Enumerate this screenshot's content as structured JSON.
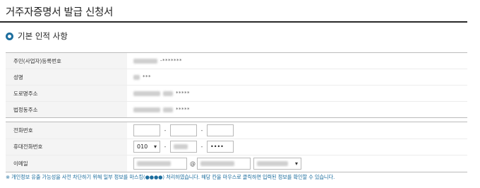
{
  "page": {
    "title": "거주자증명서 발급 신청서",
    "section_title": "기본 인적 사항"
  },
  "personal": {
    "rows": [
      {
        "label": "주민(사업자)등록번호",
        "masked": "-*******"
      },
      {
        "label": "성명",
        "masked": "***"
      },
      {
        "label": "도로명주소",
        "masked": "*****"
      },
      {
        "label": "법정동주소",
        "masked": "*****"
      }
    ]
  },
  "contact": {
    "phone_label": "전화번호",
    "mobile_label": "휴대전화번호",
    "mobile_prefix": "010",
    "mobile_last": "••••",
    "email_label": "이메일",
    "email_at": "@"
  },
  "notice": "※ 개인정보 유출 가능성을 사전 차단하기 위해 일부 정보를 마스킹(●●●●) 처리하였습니다. 해당 칸을 마우스로 클릭하면 입력된 정보를 확인할 수 있습니다.",
  "colors": {
    "accent": "#1d6e9e",
    "header_bg": "#f4f4f4",
    "title_rule": "#2a2a2a"
  }
}
